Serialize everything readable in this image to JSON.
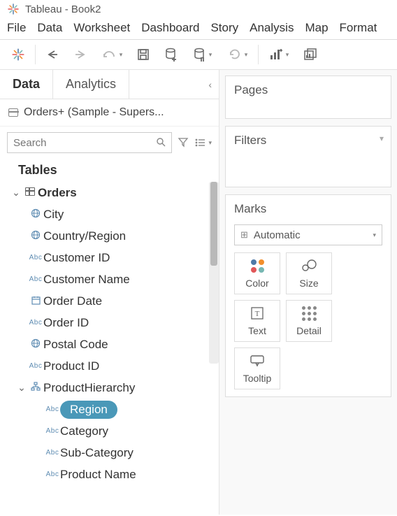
{
  "title": "Tableau - Book2",
  "menubar": [
    "File",
    "Data",
    "Worksheet",
    "Dashboard",
    "Story",
    "Analysis",
    "Map",
    "Format"
  ],
  "tabs": {
    "data": "Data",
    "analytics": "Analytics"
  },
  "datasource": "Orders+ (Sample - Supers...",
  "search": {
    "placeholder": "Search"
  },
  "tablesHeader": "Tables",
  "tree": {
    "root": "Orders",
    "items": [
      {
        "icon": "globe",
        "label": "City"
      },
      {
        "icon": "globe",
        "label": "Country/Region"
      },
      {
        "icon": "abc",
        "label": "Customer ID"
      },
      {
        "icon": "abc",
        "label": "Customer Name"
      },
      {
        "icon": "cal",
        "label": "Order Date"
      },
      {
        "icon": "abc",
        "label": "Order ID"
      },
      {
        "icon": "globe",
        "label": "Postal Code"
      },
      {
        "icon": "abc",
        "label": "Product ID"
      }
    ],
    "hierarchy": {
      "label": "ProductHierarchy",
      "children": [
        {
          "label": "Region",
          "selected": true
        },
        {
          "label": "Category"
        },
        {
          "label": "Sub-Category"
        },
        {
          "label": "Product Name"
        }
      ]
    }
  },
  "pages": {
    "title": "Pages"
  },
  "filters": {
    "title": "Filters"
  },
  "marks": {
    "title": "Marks",
    "type": "Automatic",
    "buttons": [
      "Color",
      "Size",
      "Text",
      "Detail",
      "Tooltip"
    ]
  }
}
